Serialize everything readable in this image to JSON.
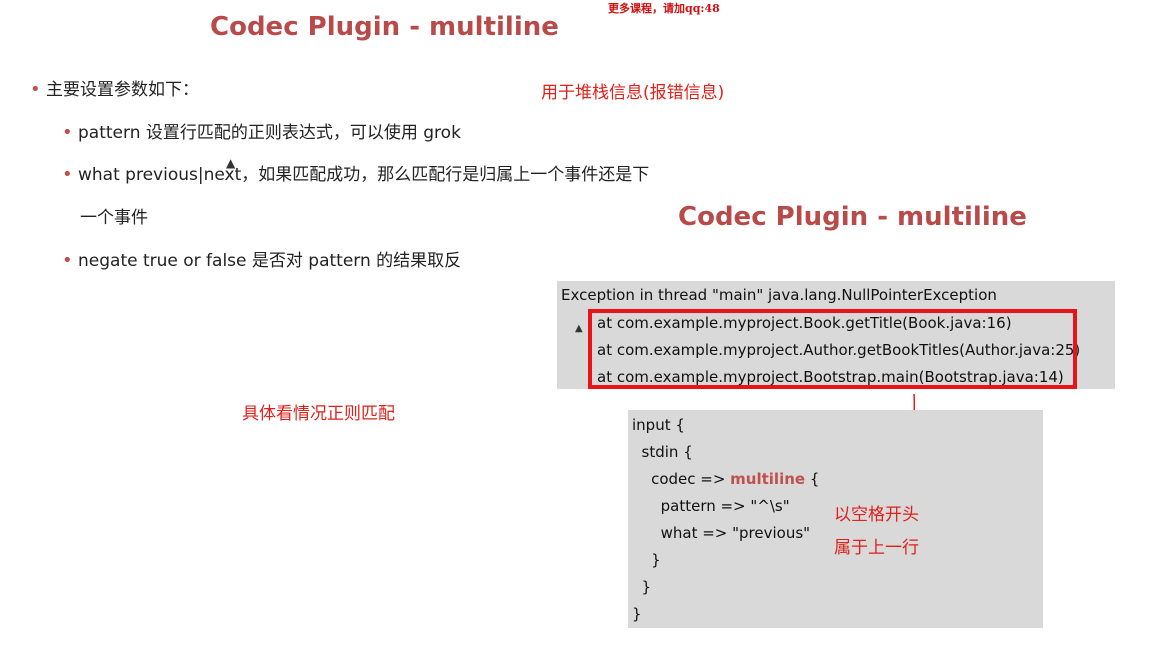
{
  "watermark": "更多课程，请加qq:48",
  "title_main": "Codec Plugin - multiline",
  "title_secondary": "Codec Plugin - multiline",
  "bullets": {
    "heading": "主要设置参数如下：",
    "pattern": "pattern 设置行匹配的正则表达式，可以使用 grok",
    "what_line1": "what previous|next，如果匹配成功，那么匹配行是归属上一个事件还是下",
    "what_line2": "一个事件",
    "negate": "negate true or false 是否对 pattern 的结果取反"
  },
  "notes": {
    "stack_info": "用于堆栈信息(报错信息)",
    "regex_note": "具体看情况正则匹配",
    "space_start": "以空格开头",
    "belongs_prev": "属于上一行"
  },
  "exception": {
    "header": "Exception in thread \"main\" java.lang.NullPointerException",
    "lines": [
      "at com.example.myproject.Book.getTitle(Book.java:16)",
      "at com.example.myproject.Author.getBookTitles(Author.java:25)",
      "at com.example.myproject.Bootstrap.main(Bootstrap.java:14)"
    ]
  },
  "code": {
    "line1": "input {",
    "line2": "  stdin {",
    "line3_pre": "    codec => ",
    "line3_kw": "multiline",
    "line3_post": " {",
    "line4": "      pattern => \"^\\s\"",
    "line5": "      what => \"previous\"",
    "line6": "    }",
    "line7": "  }",
    "line8": "}"
  },
  "colors": {
    "title": "#b94a4a",
    "annotation_red": "#e0201a",
    "box_gray": "#d9d9d9",
    "highlight_border": "#e8141a"
  }
}
